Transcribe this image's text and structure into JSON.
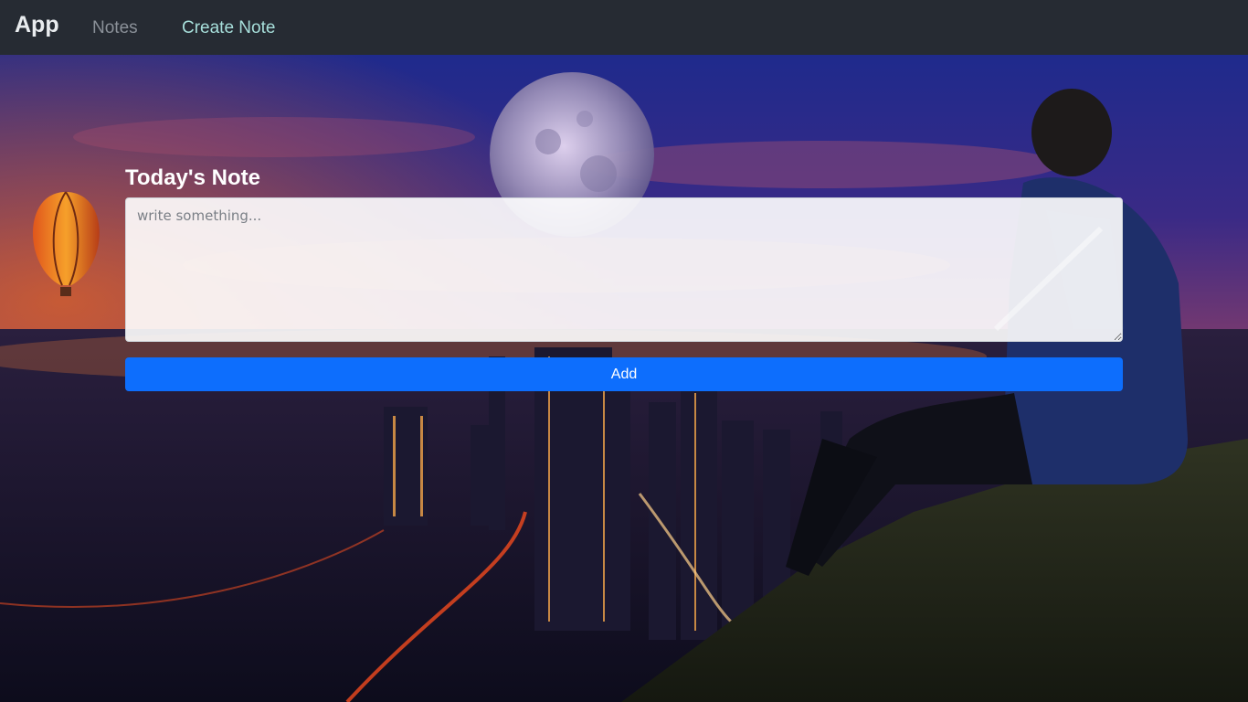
{
  "navbar": {
    "brand": "App",
    "links": [
      {
        "label": "Notes",
        "active": false
      },
      {
        "label": "Create Note",
        "active": true
      }
    ]
  },
  "form": {
    "title": "Today's Note",
    "placeholder": "write something...",
    "value": "",
    "submit_label": "Add"
  },
  "colors": {
    "navbar_bg": "#262b33",
    "active_link": "#a7dfdb",
    "inactive_link": "#8a9098",
    "button_bg": "#0d6efd"
  }
}
